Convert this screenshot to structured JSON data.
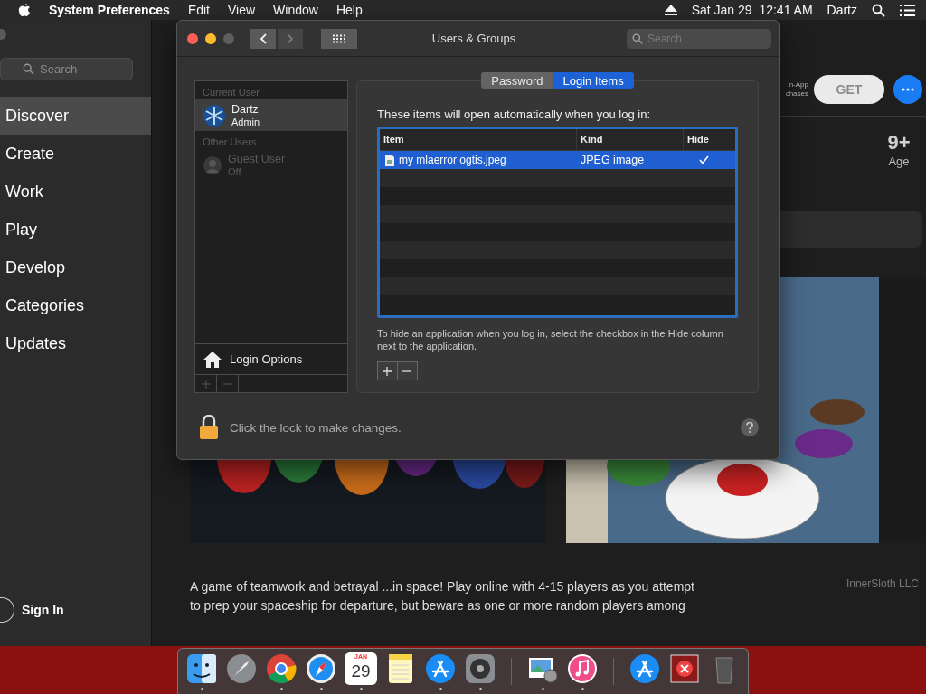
{
  "menu_bar": {
    "app": "System Preferences",
    "menus": [
      "Edit",
      "View",
      "Window",
      "Help"
    ],
    "clock": "Sat Jan 29  12:41 AM",
    "user": "Dartz"
  },
  "app_store": {
    "search": {
      "placeholder": "Search"
    },
    "nav": [
      {
        "label": "Discover",
        "selected": true
      },
      {
        "label": "Create",
        "selected": false
      },
      {
        "label": "Work",
        "selected": false
      },
      {
        "label": "Play",
        "selected": false
      },
      {
        "label": "Develop",
        "selected": false
      },
      {
        "label": "Categories",
        "selected": false
      },
      {
        "label": "Updates",
        "selected": false
      }
    ],
    "sign_in": "Sign In",
    "in_app_lines": [
      "n-App",
      "chases"
    ],
    "get_button": "GET",
    "age": {
      "value": "9+",
      "label": "Age"
    },
    "description": [
      "A game of teamwork and betrayal ...in space! Play online with 4-15 players as you attempt",
      "to prep your spaceship for departure, but beware as one or more random players among"
    ],
    "developer": "InnerSloth LLC"
  },
  "window": {
    "title": "Users & Groups",
    "search": {
      "placeholder": "Search"
    },
    "tabs": [
      {
        "label": "Password",
        "selected": false
      },
      {
        "label": "Login Items",
        "selected": true
      }
    ],
    "users": [
      {
        "section": "Current User",
        "name": "Dartz",
        "role": "Admin",
        "kind": "admin",
        "disabled": false,
        "selected": true
      },
      {
        "section": "Other Users",
        "name": "Guest User",
        "role": "Off",
        "kind": "guest",
        "disabled": true,
        "selected": false
      }
    ],
    "login_options": "Login Options",
    "intro": "These items will open automatically when you log in:",
    "table": {
      "columns": [
        "Item",
        "Kind",
        "Hide"
      ],
      "rows": [
        {
          "item": "my mlaerror ogtis.jpeg",
          "kind": "JPEG image",
          "hide": true,
          "selected": true
        }
      ]
    },
    "hint": "To hide an application when you log in, select the checkbox in the Hide column next to the application.",
    "lock_text": "Click the lock to make changes."
  },
  "dock": {
    "sections": [
      [
        {
          "kind": "finder",
          "running": true
        },
        {
          "kind": "launchpad",
          "running": false
        },
        {
          "kind": "chrome",
          "running": true
        },
        {
          "kind": "safari",
          "running": true
        },
        {
          "kind": "calendar",
          "running": true,
          "month": "JAN",
          "day": "29"
        },
        {
          "kind": "notes",
          "running": false
        },
        {
          "kind": "appstore",
          "running": true
        },
        {
          "kind": "settings",
          "running": true
        }
      ],
      [
        {
          "kind": "preview",
          "running": true
        },
        {
          "kind": "music",
          "running": true
        }
      ],
      [
        {
          "kind": "appstore",
          "running": false
        },
        {
          "kind": "error",
          "running": false
        },
        {
          "kind": "trash",
          "running": false
        }
      ]
    ]
  }
}
